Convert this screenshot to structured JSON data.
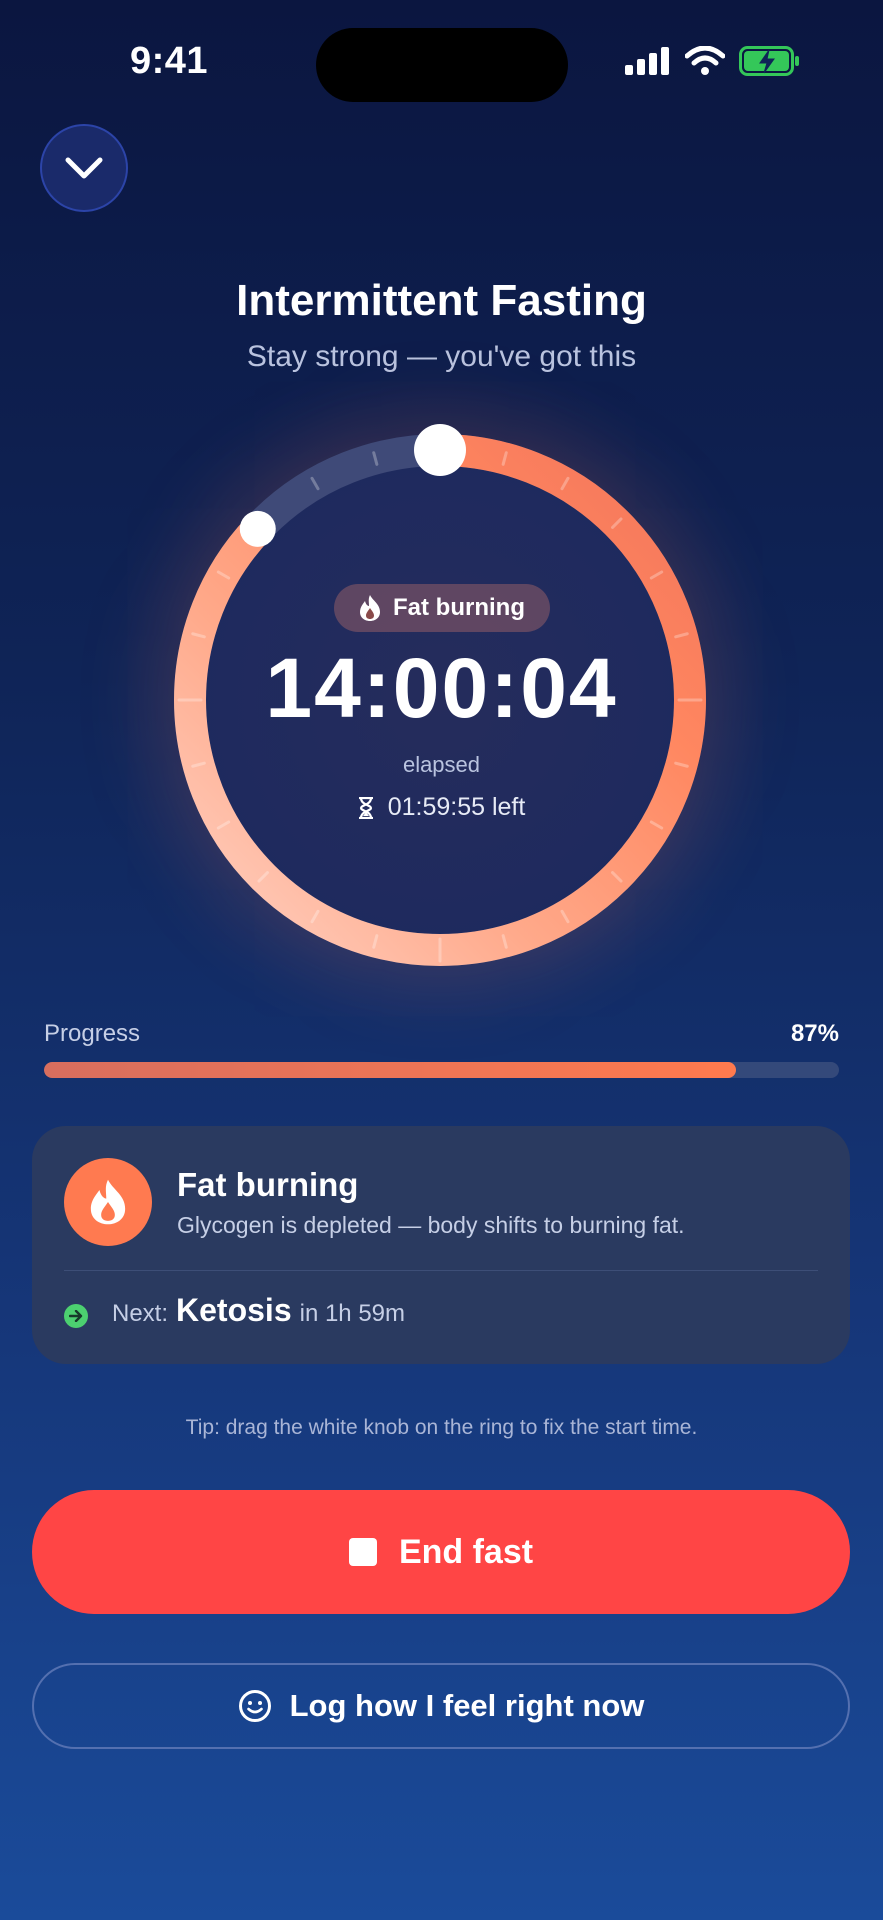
{
  "status_bar": {
    "time": "9:41"
  },
  "header": {
    "title": "Intermittent Fasting",
    "subtitle": "Stay strong — you've got this"
  },
  "timer": {
    "phase_badge": "Fat burning",
    "elapsed": "14:00:04",
    "elapsed_label": "elapsed",
    "remaining": "01:59:55 left",
    "ring_progress": 0.87
  },
  "progress": {
    "label": "Progress",
    "value_text": "87%",
    "fraction": 0.87
  },
  "phase_card": {
    "title": "Fat burning",
    "description": "Glycogen is depleted — body shifts to burning fat.",
    "next_prefix": "Next:",
    "next_name": "Ketosis",
    "next_suffix": "in 1h 59m"
  },
  "tip": "Tip: drag the white knob on the ring to fix the start time.",
  "buttons": {
    "end_fast": "End fast",
    "log_feeling": "Log how I feel right now"
  },
  "colors": {
    "accent": "#ff7a50",
    "danger": "#ff4545",
    "success": "#4cd070",
    "battery": "#34c759"
  },
  "icons": {
    "collapse": "chevron-down-icon",
    "phase": "flame-icon",
    "remaining": "hourglass-icon",
    "next": "arrow-right-circle-icon",
    "end": "stop-icon",
    "log": "smiley-icon"
  }
}
